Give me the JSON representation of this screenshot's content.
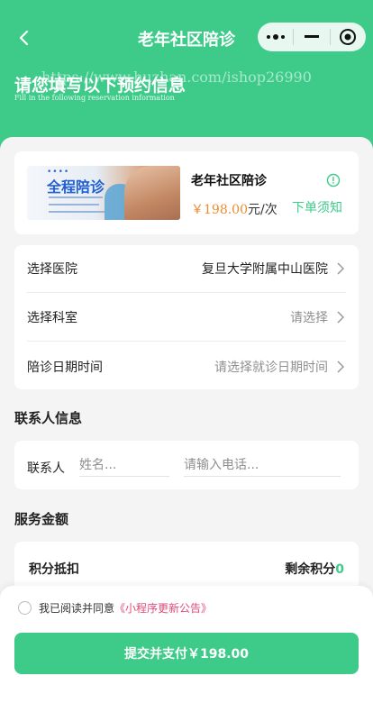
{
  "nav": {
    "title": "老年社区陪诊"
  },
  "header": {
    "watermark": "https://www.huzhan.com/ishop26990",
    "headline": "请您填写以下预约信息",
    "subline": "Fill in the following reservation information"
  },
  "product": {
    "image_title": "全程陪诊",
    "image_dots": "••••",
    "name": "老年社区陪诊",
    "price": "￥198.00",
    "price_unit": "元/次",
    "notice_label": "下单须知"
  },
  "form": {
    "hospital_label": "选择医院",
    "hospital_value": "复旦大学附属中山医院",
    "department_label": "选择科室",
    "department_value": "请选择",
    "datetime_label": "陪诊日期时间",
    "datetime_value": "请选择就诊日期时间"
  },
  "contact": {
    "section_title": "联系人信息",
    "label": "联系人",
    "name_placeholder": "姓名...",
    "phone_placeholder": "请输入电话..."
  },
  "service": {
    "section_title": "服务金额",
    "points_label": "积分抵扣",
    "remaining_label": "剩余积分",
    "remaining_value": "0"
  },
  "footer": {
    "agree_text": "我已阅读并同意",
    "agree_link": "《小程序更新公告》",
    "submit_label": "提交并支付￥198.00"
  },
  "colors": {
    "brand": "#3ecb8a",
    "price": "#ee8a2f",
    "link": "#e04c78"
  }
}
